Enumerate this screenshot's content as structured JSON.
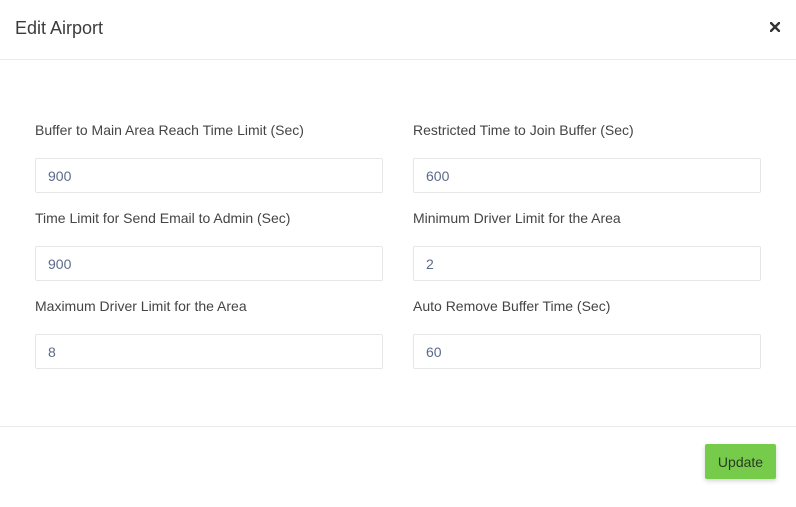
{
  "modal": {
    "title": "Edit Airport",
    "close_icon": "close-icon"
  },
  "fields": [
    {
      "label": "Buffer to Main Area Reach Time Limit (Sec)",
      "value": "900"
    },
    {
      "label": "Restricted Time to Join Buffer (Sec)",
      "value": "600"
    },
    {
      "label": "Time Limit for Send Email to Admin (Sec)",
      "value": "900"
    },
    {
      "label": "Minimum Driver Limit for the Area",
      "value": "2"
    },
    {
      "label": "Maximum Driver Limit for the Area",
      "value": "8"
    },
    {
      "label": "Auto Remove Buffer Time (Sec)",
      "value": "60"
    }
  ],
  "footer": {
    "update_label": "Update"
  },
  "colors": {
    "accent": "#76cc4a",
    "input_text": "#5c6a8a",
    "border": "#e4e6e8"
  }
}
